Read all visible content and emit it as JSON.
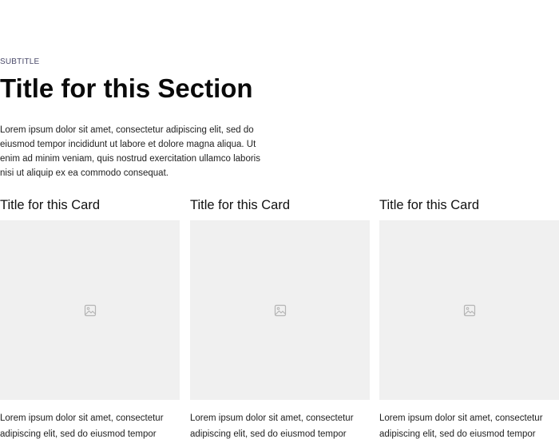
{
  "section": {
    "subtitle": "SUBTITLE",
    "title": "Title for this Section",
    "body": "Lorem ipsum dolor sit amet, consectetur adipiscing elit, sed do eiusmod tempor incididunt ut labore et dolore magna aliqua. Ut enim ad minim veniam, quis nostrud exercitation ullamco laboris nisi ut aliquip ex ea commodo consequat."
  },
  "cards": [
    {
      "title": "Title for this Card",
      "image_icon": "image-placeholder-icon",
      "body": "Lorem ipsum dolor sit amet, consectetur adipiscing elit, sed do eiusmod tempor"
    },
    {
      "title": "Title for this Card",
      "image_icon": "image-placeholder-icon",
      "body": "Lorem ipsum dolor sit amet, consectetur adipiscing elit, sed do eiusmod tempor"
    },
    {
      "title": "Title for this Card",
      "image_icon": "image-placeholder-icon",
      "body": "Lorem ipsum dolor sit amet, consectetur adipiscing elit, sed do eiusmod tempor"
    }
  ],
  "colors": {
    "image_placeholder_bg": "#f0f0f0",
    "icon": "#b5b5b5"
  }
}
